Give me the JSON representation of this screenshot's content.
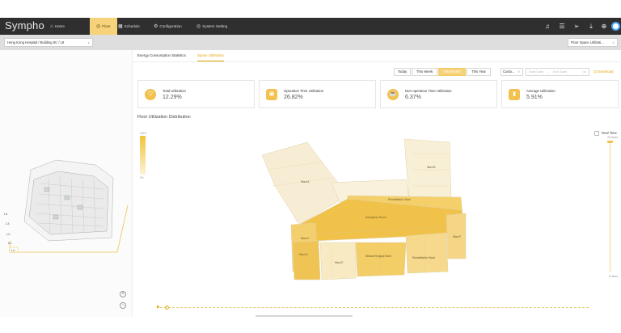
{
  "header": {
    "brand": "Sympho",
    "brand_suffix": "",
    "nav": [
      {
        "label": "Home",
        "icon": "home-icon"
      },
      {
        "label": "Floor",
        "icon": "floor-icon",
        "active": true
      },
      {
        "label": "Schedule",
        "icon": "calendar-icon"
      },
      {
        "label": "Configuration",
        "icon": "gear-icon"
      },
      {
        "label": "System Setting",
        "icon": "settings-icon"
      }
    ],
    "right_icons": [
      "bell-icon",
      "menu-icon",
      "send-icon",
      "download-icon",
      "globe-icon",
      "avatar"
    ]
  },
  "subbar": {
    "site_select": "Hong Kong Hospital / Building 8C / L8",
    "space_select": "Floor Space Utilizati..."
  },
  "left_panel": {
    "floor_labels": [
      "L4",
      "L3",
      "L2",
      "L1",
      "L0"
    ],
    "zoom_in": "+",
    "zoom_out": "−"
  },
  "tabs": [
    {
      "label": "Energy Consumption Statistics",
      "active": false
    },
    {
      "label": "Space Utilization",
      "active": true
    }
  ],
  "periods": [
    {
      "label": "Today",
      "active": false
    },
    {
      "label": "This Week",
      "active": false
    },
    {
      "label": "This Month",
      "active": true
    },
    {
      "label": "This Year",
      "active": false
    }
  ],
  "custom_select": "Custo...",
  "date_range": {
    "start": "Start Date",
    "sep": "→",
    "end": "End Date"
  },
  "download_label": "Download",
  "cards": [
    {
      "label": "Total Utilization",
      "value": "12.29%",
      "icon": "shield-icon"
    },
    {
      "label": "Operation Time Utilization",
      "value": "26.82%",
      "icon": "briefcase-icon"
    },
    {
      "label": "Non-operation Time Utilization",
      "value": "6.37%",
      "icon": "cup-icon"
    },
    {
      "label": "Average Utilization",
      "value": "5.91%",
      "icon": "bar-chart-icon"
    }
  ],
  "section_title": "Floor Utilization Distribution",
  "legend": {
    "max": "100%",
    "min": "0%"
  },
  "rooms": [
    "Ward A",
    "Ward B",
    "Rehabilitation Ward",
    "Emergency Room",
    "Ward C",
    "Ward D",
    "Ward E",
    "Medical Surgical Ward",
    "Rehabilitation Ward",
    "Ward F"
  ],
  "realtime": {
    "label": "Real Time",
    "top": "24 Hours",
    "bottom": "0 Hours"
  },
  "colors": {
    "accent": "#f3c24e",
    "topbar": "#2f2f2f",
    "highlight": "#f6d27a"
  }
}
